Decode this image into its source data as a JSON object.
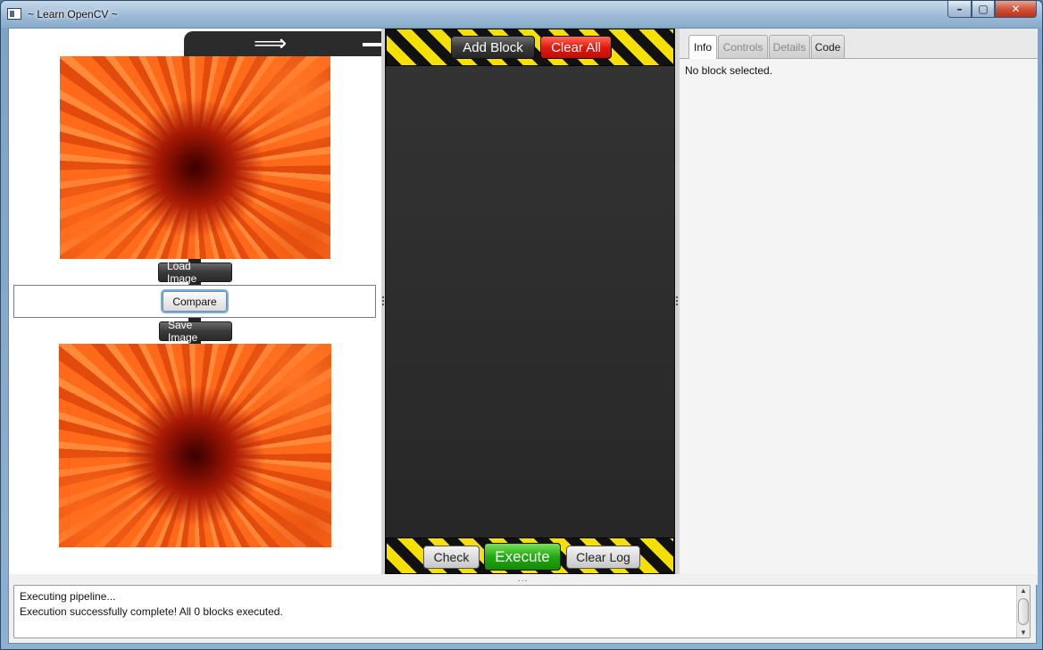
{
  "window": {
    "title": "~ Learn OpenCV ~",
    "min_glyph": "–",
    "max_glyph": "▢",
    "close_glyph": "✕"
  },
  "left": {
    "connector_arrow": "⟹",
    "load_label": "Load Image",
    "compare_label": "Compare",
    "save_label": "Save Image"
  },
  "middle": {
    "add_block_label": "Add Block",
    "clear_all_label": "Clear All",
    "check_label": "Check",
    "execute_label": "Execute",
    "clear_log_label": "Clear Log"
  },
  "right": {
    "tabs": [
      {
        "label": "Info",
        "active": true,
        "enabled": true
      },
      {
        "label": "Controls",
        "active": false,
        "enabled": false
      },
      {
        "label": "Details",
        "active": false,
        "enabled": false
      },
      {
        "label": "Code",
        "active": false,
        "enabled": true
      }
    ],
    "info_text": "No block selected."
  },
  "log": {
    "lines": [
      "Executing pipeline...",
      "Execution successfully complete! All 0 blocks executed."
    ],
    "splitter_dots": "...",
    "scroll_up": "▲",
    "scroll_down": "▼"
  },
  "colors": {
    "hazard_yellow": "#f5e000",
    "clear_all_red": "#e01a10",
    "execute_green": "#22a812",
    "pane_dark": "#2b2b2b"
  }
}
